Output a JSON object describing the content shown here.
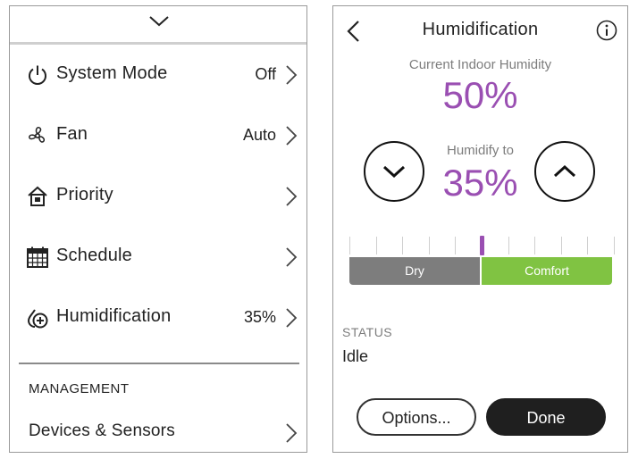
{
  "left_panel": {
    "collapse_icon": "chevron-down-icon",
    "menu": [
      {
        "icon": "power-icon",
        "label": "System Mode",
        "value": "Off"
      },
      {
        "icon": "fan-icon",
        "label": "Fan",
        "value": "Auto"
      },
      {
        "icon": "priority-home-icon",
        "label": "Priority",
        "value": ""
      },
      {
        "icon": "calendar-icon",
        "label": "Schedule",
        "value": ""
      },
      {
        "icon": "humidity-drop-icon",
        "label": "Humidification",
        "value": "35%"
      }
    ],
    "management_header": "MANAGEMENT",
    "management_items": [
      {
        "label": "Devices & Sensors"
      }
    ]
  },
  "right_panel": {
    "title": "Humidification",
    "current_label": "Current Indoor Humidity",
    "current_value": "50%",
    "target_label": "Humidify to",
    "target_value": "35%",
    "scale": {
      "dry_label": "Dry",
      "comfort_label": "Comfort",
      "marker_fraction": 0.5,
      "tick_count": 10
    },
    "status_header": "STATUS",
    "status_value": "Idle",
    "options_label": "Options...",
    "done_label": "Done"
  },
  "colors": {
    "accent_purple": "#9a4fb2",
    "dry_gray": "#7d7d7d",
    "comfort_green": "#80c342",
    "done_dark": "#1f1f1f"
  }
}
